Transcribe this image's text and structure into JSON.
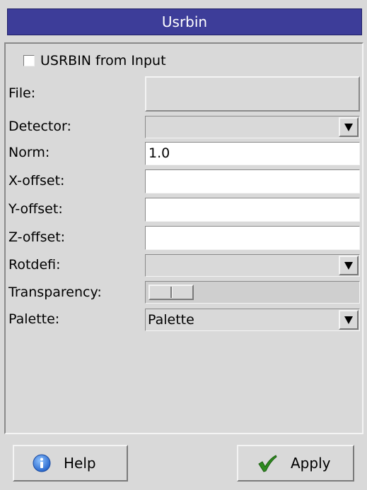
{
  "window": {
    "title": "Usrbin"
  },
  "form": {
    "usrbin_from_input_label": "USRBIN from Input",
    "usrbin_from_input_checked": false,
    "file_label": "File:",
    "file_value": "",
    "detector_label": "Detector:",
    "detector_value": "",
    "norm_label": "Norm:",
    "norm_value": "1.0",
    "xoffset_label": "X-offset:",
    "xoffset_value": "",
    "yoffset_label": "Y-offset:",
    "yoffset_value": "",
    "zoffset_label": "Z-offset:",
    "zoffset_value": "",
    "rotdefi_label": "Rotdefi:",
    "rotdefi_value": "",
    "transparency_label": "Transparency:",
    "transparency_value": 0,
    "palette_label": "Palette:",
    "palette_value": "Palette"
  },
  "buttons": {
    "help_label": "Help",
    "apply_label": "Apply"
  },
  "icons": {
    "help": "info-icon",
    "apply": "checkmark-icon",
    "combo_arrow": "triangle-down-icon"
  },
  "colors": {
    "title_bar": "#3d3d99",
    "background": "#d9d9d9",
    "info_icon": "#2a6fd6",
    "checkmark_icon": "#2e8b1f"
  }
}
